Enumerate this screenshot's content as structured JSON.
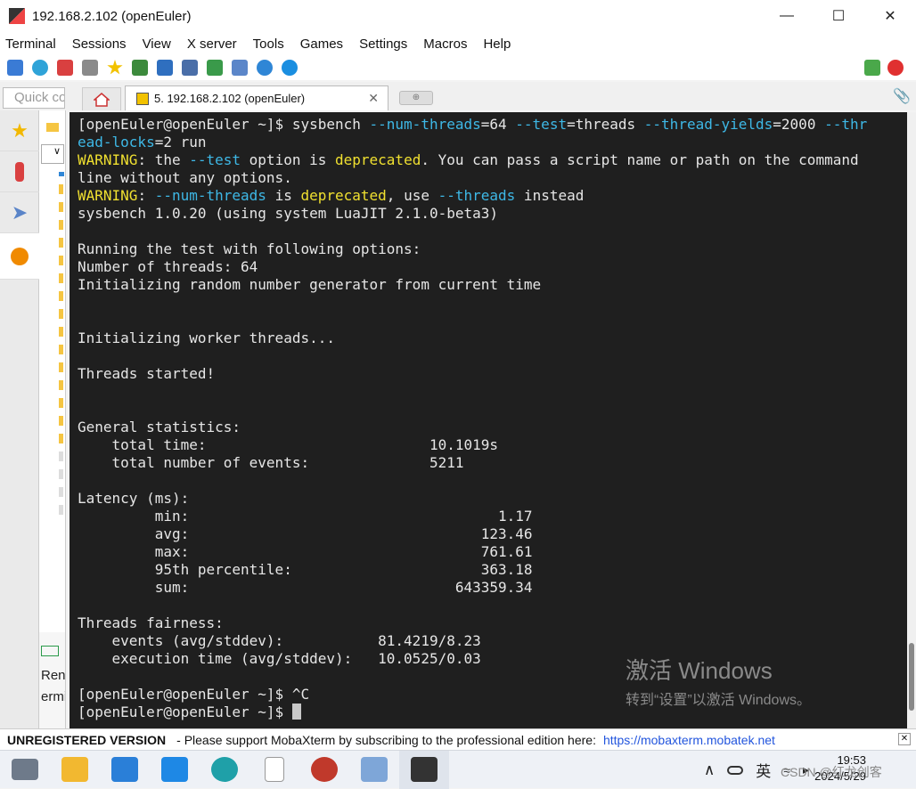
{
  "window": {
    "title": "192.168.2.102 (openEuler)",
    "minimize": "—",
    "maximize": "☐",
    "close": "✕"
  },
  "menu": [
    "Terminal",
    "Sessions",
    "View",
    "X server",
    "Tools",
    "Games",
    "Settings",
    "Macros",
    "Help"
  ],
  "tabs": {
    "quick_connect_placeholder": "Quick connect...",
    "session_tab_label": "5. 192.168.2.102 (openEuler)",
    "tab_close": "✕",
    "new_tab": "⊕"
  },
  "terminal": {
    "lines": [
      [
        {
          "t": "[openEuler@openEuler ~]$ sysbench "
        },
        {
          "t": "--num-threads",
          "c": "opt"
        },
        {
          "t": "=64 "
        },
        {
          "t": "--test",
          "c": "opt"
        },
        {
          "t": "=threads "
        },
        {
          "t": "--thread-yields",
          "c": "opt"
        },
        {
          "t": "=2000 "
        },
        {
          "t": "--thr",
          "c": "opt"
        }
      ],
      [
        {
          "t": "ead-locks",
          "c": "opt"
        },
        {
          "t": "=2 run"
        }
      ],
      [
        {
          "t": "WARNING",
          "c": "warn"
        },
        {
          "t": ": the "
        },
        {
          "t": "--test",
          "c": "opt"
        },
        {
          "t": " option is "
        },
        {
          "t": "deprecated",
          "c": "warn"
        },
        {
          "t": ". You can pass a script name or path on the command"
        }
      ],
      [
        {
          "t": "line without any options."
        }
      ],
      [
        {
          "t": "WARNING",
          "c": "warn"
        },
        {
          "t": ": "
        },
        {
          "t": "--num-threads",
          "c": "opt"
        },
        {
          "t": " is "
        },
        {
          "t": "deprecated",
          "c": "warn"
        },
        {
          "t": ", use "
        },
        {
          "t": "--threads",
          "c": "opt"
        },
        {
          "t": " instead"
        }
      ],
      [
        {
          "t": "sysbench 1.0.20 (using system LuaJIT 2.1.0-beta3)"
        }
      ],
      [
        {
          "t": ""
        }
      ],
      [
        {
          "t": "Running the test with following options:"
        }
      ],
      [
        {
          "t": "Number of threads: 64"
        }
      ],
      [
        {
          "t": "Initializing random number generator from current time"
        }
      ],
      [
        {
          "t": ""
        }
      ],
      [
        {
          "t": ""
        }
      ],
      [
        {
          "t": "Initializing worker threads..."
        }
      ],
      [
        {
          "t": ""
        }
      ],
      [
        {
          "t": "Threads started!"
        }
      ],
      [
        {
          "t": ""
        }
      ],
      [
        {
          "t": ""
        }
      ],
      [
        {
          "t": "General statistics:"
        }
      ],
      [
        {
          "t": "    total time:                          10.1019s"
        }
      ],
      [
        {
          "t": "    total number of events:              5211"
        }
      ],
      [
        {
          "t": ""
        }
      ],
      [
        {
          "t": "Latency (ms):"
        }
      ],
      [
        {
          "t": "         min:                                    1.17"
        }
      ],
      [
        {
          "t": "         avg:                                  123.46"
        }
      ],
      [
        {
          "t": "         max:                                  761.61"
        }
      ],
      [
        {
          "t": "         95th percentile:                      363.18"
        }
      ],
      [
        {
          "t": "         sum:                               643359.34"
        }
      ],
      [
        {
          "t": ""
        }
      ],
      [
        {
          "t": "Threads fairness:"
        }
      ],
      [
        {
          "t": "    events (avg/stddev):           81.4219/8.23"
        }
      ],
      [
        {
          "t": "    execution time (avg/stddev):   10.0525/0.03"
        }
      ],
      [
        {
          "t": ""
        }
      ],
      [
        {
          "t": "[openEuler@openEuler ~]$ ^C"
        }
      ],
      [
        {
          "t": "[openEuler@openEuler ~]$ "
        },
        {
          "cursor": true
        }
      ]
    ]
  },
  "watermark": {
    "title": "激活 Windows",
    "subtitle": "转到“设置”以激活 Windows。"
  },
  "sftp": {
    "bottom_items": [
      "Ren",
      "ermi"
    ]
  },
  "statusbar": {
    "unregistered": "UNREGISTERED VERSION",
    "message": "-  Please support MobaXterm by subscribing to the professional edition here:",
    "link": "https://mobaxterm.mobatek.net",
    "close": "✕"
  },
  "taskbar": {
    "tray_chevron": "∧",
    "ime": "英",
    "time": "19:53",
    "date": "2024/5/29",
    "credit": "CSDN @红龙创客"
  },
  "colors": {
    "terminal_bg": "#1f1f1f",
    "option": "#3eb8e6",
    "warning": "#f0e030"
  }
}
